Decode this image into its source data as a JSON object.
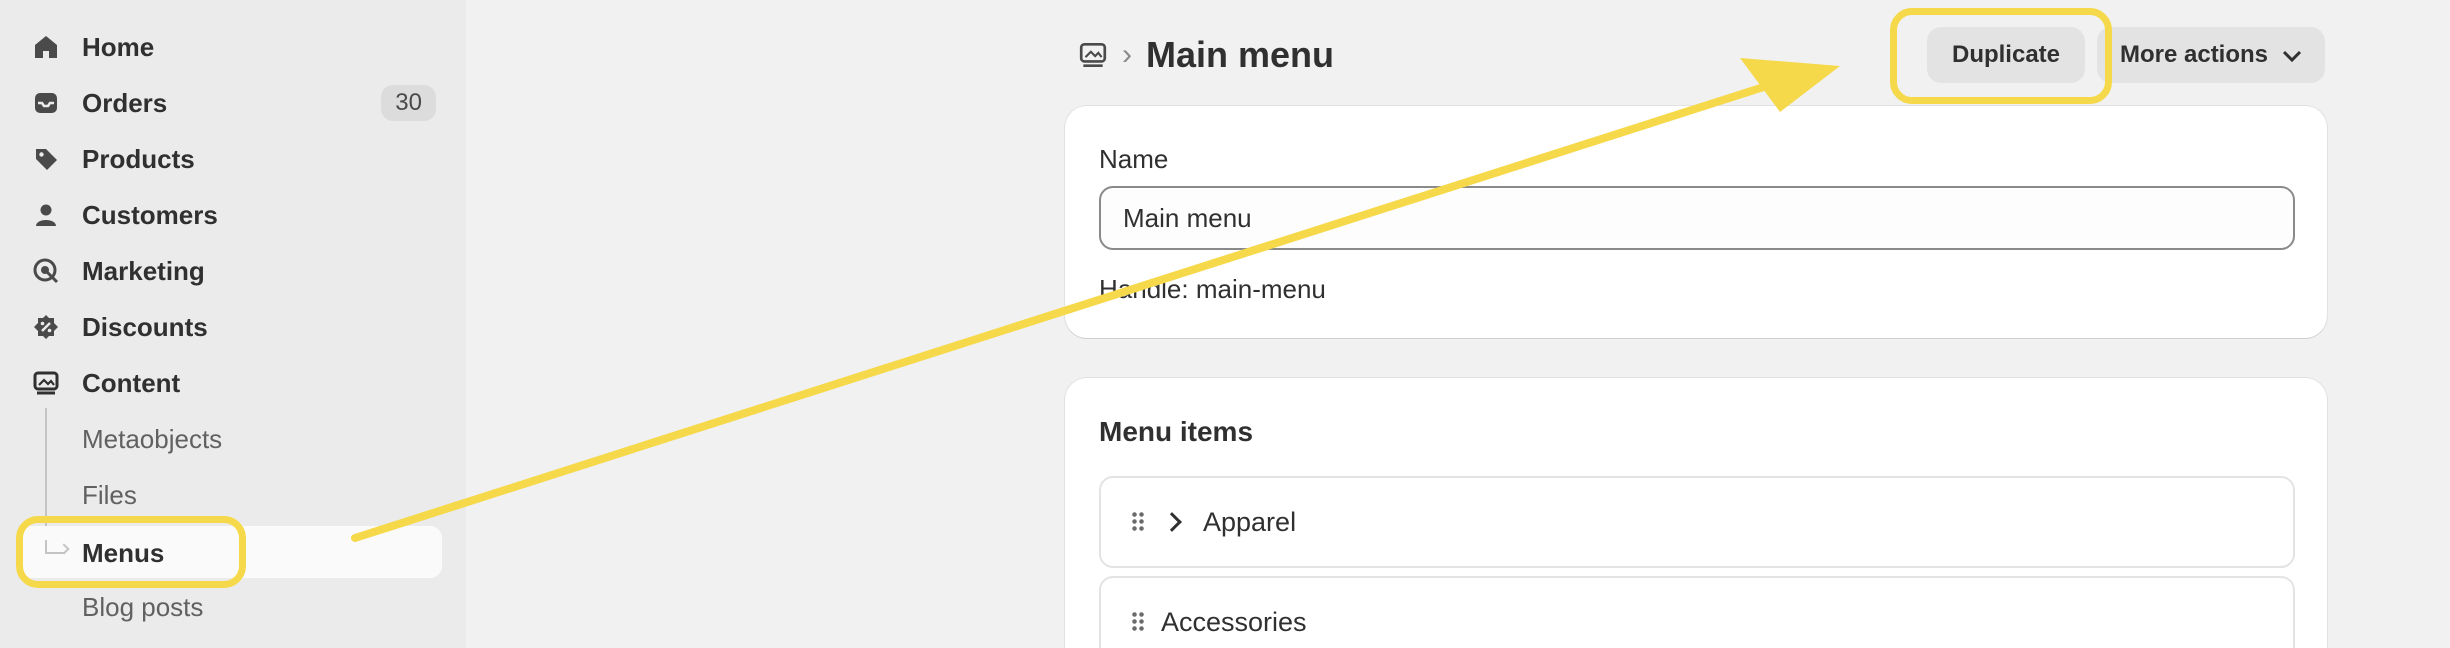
{
  "sidebar": {
    "items": [
      {
        "label": "Home",
        "icon": "home-icon"
      },
      {
        "label": "Orders",
        "icon": "inbox-icon",
        "badge": "30"
      },
      {
        "label": "Products",
        "icon": "tag-icon"
      },
      {
        "label": "Customers",
        "icon": "person-icon"
      },
      {
        "label": "Marketing",
        "icon": "target-icon"
      },
      {
        "label": "Discounts",
        "icon": "discount-icon"
      },
      {
        "label": "Content",
        "icon": "image-icon"
      }
    ],
    "content_subitems": [
      {
        "label": "Metaobjects"
      },
      {
        "label": "Files"
      },
      {
        "label": "Menus",
        "active": true
      },
      {
        "label": "Blog posts"
      }
    ]
  },
  "header": {
    "title": "Main menu",
    "duplicate_label": "Duplicate",
    "more_actions_label": "More actions"
  },
  "name_card": {
    "name_label": "Name",
    "name_value": "Main menu",
    "handle_text": "Handle: main-menu"
  },
  "menu_items_card": {
    "title": "Menu items",
    "items": [
      {
        "label": "Apparel",
        "has_children": true
      },
      {
        "label": "Accessories",
        "has_children": false
      }
    ]
  },
  "annotation": {
    "highlight_color": "#f5d94a"
  }
}
